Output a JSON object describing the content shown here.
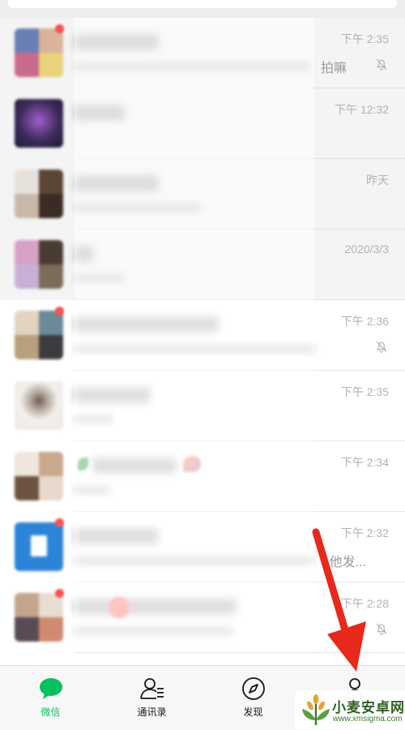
{
  "colors": {
    "accent": "#07c160",
    "badge": "#fa5151",
    "arrow": "#e8281a",
    "time_text": "#b2b2b2"
  },
  "chats": [
    {
      "time": "下午 2:35",
      "tail": "拍嘛",
      "muted": true,
      "badge": true,
      "pinned": true,
      "avatar": [
        "#6a7fb5",
        "#d9b39a",
        "#c86a8c",
        "#e8d27a"
      ]
    },
    {
      "time": "下午 12:32",
      "tail": "",
      "muted": false,
      "badge": false,
      "pinned": true,
      "avatar": [
        "#3b2b5a",
        "#a05fc9",
        "#221833",
        "#8e67c0"
      ],
      "single": true
    },
    {
      "time": "昨天",
      "tail": "",
      "muted": false,
      "badge": false,
      "pinned": true,
      "avatar": [
        "#e7e1dc",
        "#5b4636",
        "#c9b7a9",
        "#3a2c24"
      ]
    },
    {
      "time": "2020/3/3",
      "tail": "",
      "muted": false,
      "badge": false,
      "pinned": true,
      "avatar": [
        "#d6a2c6",
        "#4a3c35",
        "#c7b0d8",
        "#7d6b59"
      ]
    },
    {
      "time": "下午 2:36",
      "tail": "",
      "muted": true,
      "badge": true,
      "pinned": false,
      "avatar": [
        "#e2d4c0",
        "#6a8a9a",
        "#b89f7e",
        "#3d3a40"
      ]
    },
    {
      "time": "下午 2:35",
      "tail": "",
      "muted": false,
      "badge": false,
      "pinned": false,
      "avatar": [
        "#f2efec",
        "#d8cfc8",
        "#b3a59a",
        "#ede8e4"
      ],
      "single": true
    },
    {
      "time": "下午 2:34",
      "tail": "",
      "muted": false,
      "badge": false,
      "pinned": false,
      "avatar": [
        "#efe6dc",
        "#c9a98e",
        "#6d5442",
        "#e8d8cc"
      ]
    },
    {
      "time": "下午 2:32",
      "tail": "他发...",
      "muted": false,
      "badge": true,
      "pinned": false,
      "avatar": [
        "#2b84d8",
        "#2b84d8",
        "#2b84d8",
        "#2b84d8"
      ],
      "doc": true
    },
    {
      "time": "下午 2:28",
      "tail": "",
      "muted": true,
      "badge": true,
      "pinned": false,
      "avatar": [
        "#c2a58d",
        "#e9ddd2",
        "#5a4a56",
        "#d08a6f"
      ]
    }
  ],
  "tabs": [
    {
      "label": "微信",
      "icon": "chat-icon",
      "active": true
    },
    {
      "label": "通讯录",
      "icon": "contacts-icon",
      "active": false
    },
    {
      "label": "发现",
      "icon": "compass-icon",
      "active": false
    },
    {
      "label": "",
      "icon": "me-icon",
      "active": false
    }
  ],
  "watermark": {
    "title": "小麦安卓网",
    "url": "www.xmsigma.com"
  }
}
